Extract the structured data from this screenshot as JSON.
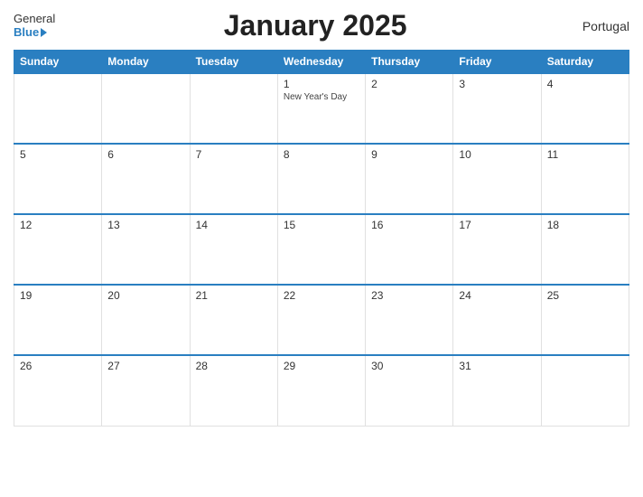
{
  "header": {
    "logo_general": "General",
    "logo_blue": "Blue",
    "title": "January 2025",
    "country": "Portugal"
  },
  "days_of_week": [
    "Sunday",
    "Monday",
    "Tuesday",
    "Wednesday",
    "Thursday",
    "Friday",
    "Saturday"
  ],
  "weeks": [
    [
      {
        "day": "",
        "empty": true
      },
      {
        "day": "",
        "empty": true
      },
      {
        "day": "",
        "empty": true
      },
      {
        "day": "1",
        "holiday": "New Year's Day"
      },
      {
        "day": "2",
        "holiday": ""
      },
      {
        "day": "3",
        "holiday": ""
      },
      {
        "day": "4",
        "holiday": ""
      }
    ],
    [
      {
        "day": "5",
        "holiday": ""
      },
      {
        "day": "6",
        "holiday": ""
      },
      {
        "day": "7",
        "holiday": ""
      },
      {
        "day": "8",
        "holiday": ""
      },
      {
        "day": "9",
        "holiday": ""
      },
      {
        "day": "10",
        "holiday": ""
      },
      {
        "day": "11",
        "holiday": ""
      }
    ],
    [
      {
        "day": "12",
        "holiday": ""
      },
      {
        "day": "13",
        "holiday": ""
      },
      {
        "day": "14",
        "holiday": ""
      },
      {
        "day": "15",
        "holiday": ""
      },
      {
        "day": "16",
        "holiday": ""
      },
      {
        "day": "17",
        "holiday": ""
      },
      {
        "day": "18",
        "holiday": ""
      }
    ],
    [
      {
        "day": "19",
        "holiday": ""
      },
      {
        "day": "20",
        "holiday": ""
      },
      {
        "day": "21",
        "holiday": ""
      },
      {
        "day": "22",
        "holiday": ""
      },
      {
        "day": "23",
        "holiday": ""
      },
      {
        "day": "24",
        "holiday": ""
      },
      {
        "day": "25",
        "holiday": ""
      }
    ],
    [
      {
        "day": "26",
        "holiday": ""
      },
      {
        "day": "27",
        "holiday": ""
      },
      {
        "day": "28",
        "holiday": ""
      },
      {
        "day": "29",
        "holiday": ""
      },
      {
        "day": "30",
        "holiday": ""
      },
      {
        "day": "31",
        "holiday": ""
      },
      {
        "day": "",
        "empty": true
      }
    ]
  ]
}
